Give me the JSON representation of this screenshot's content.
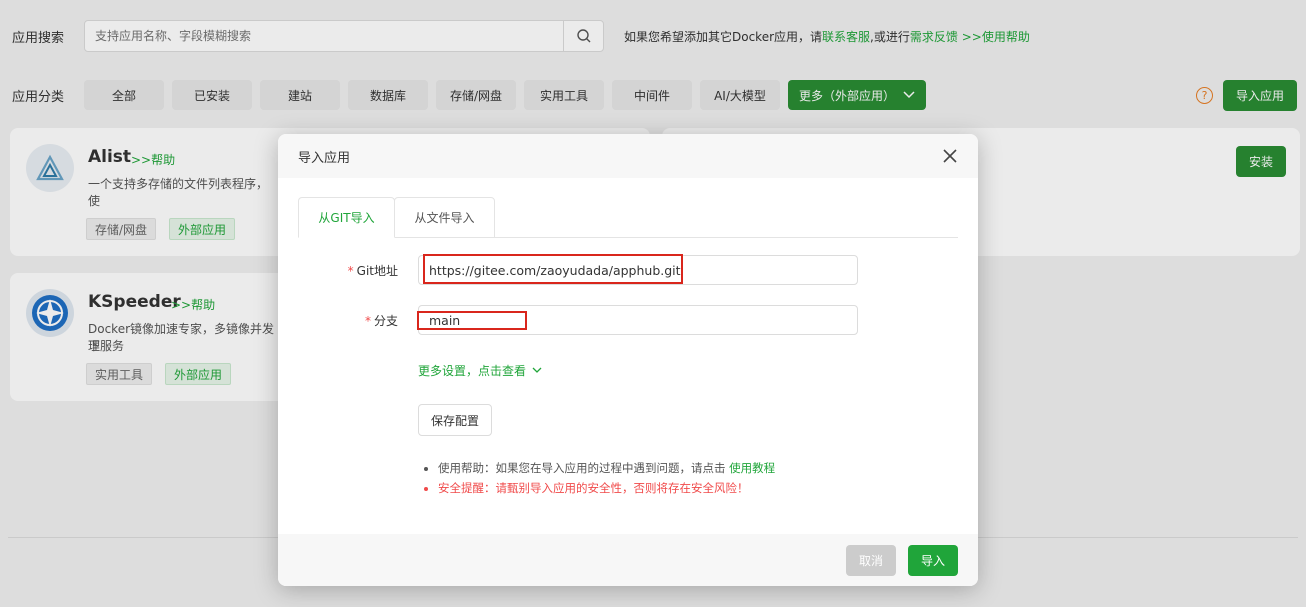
{
  "search": {
    "label": "应用搜索",
    "placeholder": "支持应用名称、字段模糊搜索",
    "hint_prefix": "如果您希望添加其它Docker应用，请",
    "hint_link1": "联系客服",
    "hint_mid": ",或进行",
    "hint_link2": "需求反馈",
    "hint_link3": " >>使用帮助"
  },
  "categories": {
    "label": "应用分类",
    "items": [
      "全部",
      "已安装",
      "建站",
      "数据库",
      "存储/网盘",
      "实用工具",
      "中间件",
      "AI/大模型"
    ],
    "more_label": "更多（外部应用）",
    "help_symbol": "?",
    "import_button": "导入应用"
  },
  "apps": [
    {
      "name": "Alist",
      "help": ">>帮助",
      "desc": "一个支持多存储的文件列表程序，使",
      "tags": [
        "存储/网盘",
        "外部应用"
      ]
    },
    {
      "name": "KSpeeder",
      "help": ">>帮助",
      "desc_line1": "Docker镜像加速专家，多镜像并发下",
      "desc_line2": "理服务",
      "tags": [
        "实用工具",
        "外部应用"
      ]
    }
  ],
  "install_button": "安装",
  "modal": {
    "title": "导入应用",
    "tabs": [
      "从GIT导入",
      "从文件导入"
    ],
    "fields": [
      {
        "label": "Git地址",
        "required": "*",
        "value": "https://gitee.com/zaoyudada/apphub.git"
      },
      {
        "label": "分支",
        "required": "*",
        "value": "main"
      }
    ],
    "more_settings": "更多设置，点击查看",
    "save_button": "保存配置",
    "tip1_text": "使用帮助：如果您在导入应用的过程中遇到问题，请点击 ",
    "tip1_link": "使用教程",
    "tip2_text": "安全提醒：请甄别导入应用的安全性，否则将存在安全风险！",
    "cancel_button": "取消",
    "import_button": "导入"
  },
  "colors": {
    "brand_green": "#20a53a",
    "dark_green": "#2a8c34",
    "warning_red": "#f04a4a",
    "highlight_red": "#d9261c"
  }
}
